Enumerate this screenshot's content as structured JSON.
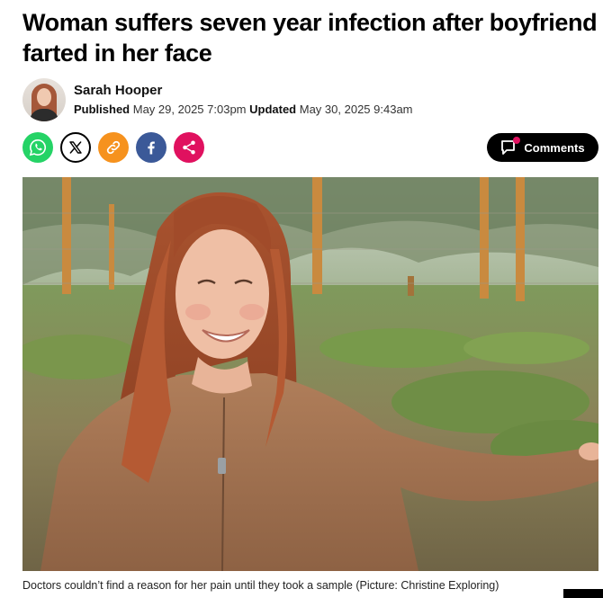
{
  "article": {
    "headline": "Woman suffers seven year infection after boyfriend farted in her face"
  },
  "byline": {
    "author": "Sarah Hooper",
    "published_label": "Published",
    "published_date": "May 29, 2025 7:03pm",
    "updated_label": "Updated",
    "updated_date": "May 30, 2025 9:43am"
  },
  "share": {
    "buttons": [
      {
        "icon": "whatsapp-icon",
        "color": "#25d366"
      },
      {
        "icon": "x-icon",
        "color": "#ffffff"
      },
      {
        "icon": "link-icon",
        "color": "#f6921e"
      },
      {
        "icon": "facebook-icon",
        "color": "#3b5998"
      },
      {
        "icon": "share-icon",
        "color": "#e0115f"
      }
    ]
  },
  "comments": {
    "label": "Comments",
    "icon": "comment-bubble-icon"
  },
  "image": {
    "caption": "Doctors couldn’t find a reason for her pain until they took a sample (Picture: Christine Exploring)"
  }
}
